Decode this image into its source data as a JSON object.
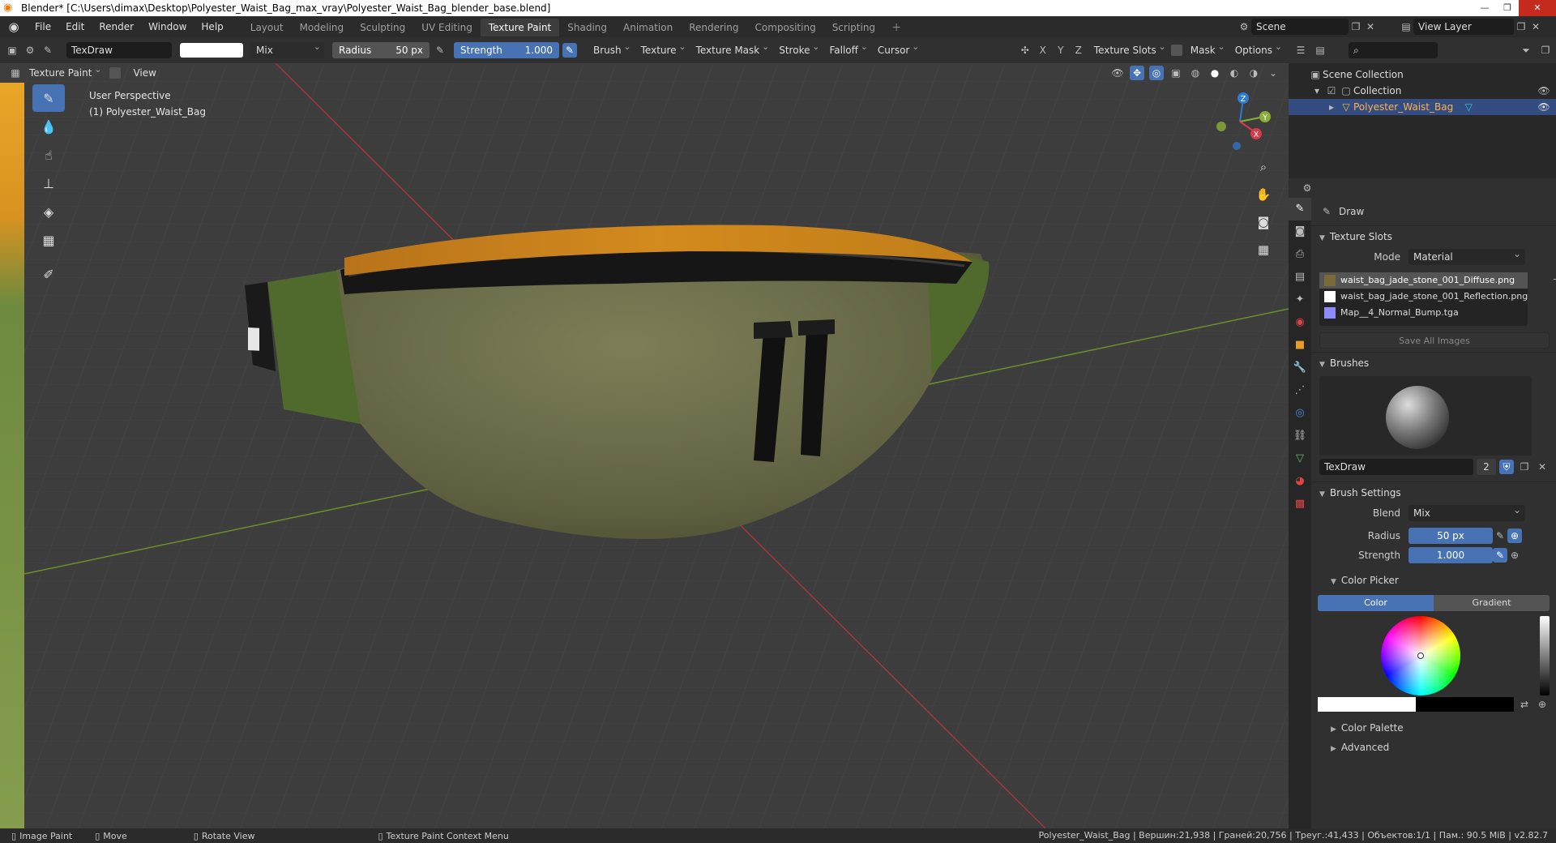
{
  "window": {
    "title": "Blender* [C:\\Users\\dimax\\Desktop\\Polyester_Waist_Bag_max_vray\\Polyester_Waist_Bag_blender_base.blend]"
  },
  "menus": [
    "File",
    "Edit",
    "Render",
    "Window",
    "Help"
  ],
  "workspaces": [
    {
      "label": "Layout",
      "active": false
    },
    {
      "label": "Modeling",
      "active": false
    },
    {
      "label": "Sculpting",
      "active": false
    },
    {
      "label": "UV Editing",
      "active": false
    },
    {
      "label": "Texture Paint",
      "active": true
    },
    {
      "label": "Shading",
      "active": false
    },
    {
      "label": "Animation",
      "active": false
    },
    {
      "label": "Rendering",
      "active": false
    },
    {
      "label": "Compositing",
      "active": false
    },
    {
      "label": "Scripting",
      "active": false
    }
  ],
  "topright": {
    "scene": "Scene",
    "view_layer": "View Layer"
  },
  "toolheader": {
    "brush_name": "TexDraw",
    "blend": "Mix",
    "radius_label": "Radius",
    "radius_value": "50 px",
    "strength_label": "Strength",
    "strength_value": "1.000",
    "menus": [
      "Brush",
      "Texture",
      "Texture Mask",
      "Stroke",
      "Falloff",
      "Cursor"
    ],
    "axes": [
      "X",
      "Y",
      "Z"
    ],
    "right_menus": [
      "Texture Slots",
      "Mask",
      "Options"
    ]
  },
  "viewheader": {
    "mode": "Texture Paint",
    "view": "View"
  },
  "viewport": {
    "perspective": "User Perspective",
    "object": "(1) Polyester_Waist_Bag",
    "gizmo": {
      "z": "Z",
      "y": "Y",
      "x": "X"
    }
  },
  "tools": [
    "brush-icon",
    "fill-icon",
    "smear-icon",
    "clone-icon",
    "mask-fill-icon",
    "clone-stamp-icon",
    "annotate-icon"
  ],
  "outliner": {
    "root": "Scene Collection",
    "collection": "Collection",
    "object": "Polyester_Waist_Bag"
  },
  "properties": {
    "tool_name": "Draw",
    "texture_slots": {
      "title": "Texture Slots",
      "mode_label": "Mode",
      "mode": "Material",
      "slots": [
        {
          "name": "waist_bag_jade_stone_001_Diffuse.png",
          "color": "#7a6a3a",
          "active": true
        },
        {
          "name": "waist_bag_jade_stone_001_Reflection.png",
          "color": "#ffffff",
          "active": false
        },
        {
          "name": "Map__4_Normal_Bump.tga",
          "color": "#8c8cff",
          "active": false
        }
      ],
      "save_all": "Save All Images"
    },
    "brushes": {
      "title": "Brushes",
      "name": "TexDraw",
      "users": "2"
    },
    "brush_settings": {
      "title": "Brush Settings",
      "blend_label": "Blend",
      "blend": "Mix",
      "radius_label": "Radius",
      "radius": "50 px",
      "strength_label": "Strength",
      "strength": "1.000"
    },
    "color_picker": {
      "title": "Color Picker",
      "tab_color": "Color",
      "tab_gradient": "Gradient"
    },
    "color_palette": "Color Palette",
    "advanced": "Advanced"
  },
  "statusbar": {
    "left": [
      {
        "icon": "mouse-left-icon",
        "label": "Image Paint"
      },
      {
        "icon": "mouse-drag-icon",
        "label": "Move"
      },
      {
        "icon": "mouse-middle-icon",
        "label": "Rotate View"
      },
      {
        "icon": "mouse-right-icon",
        "label": "Texture Paint Context Menu"
      }
    ],
    "stats": "Polyester_Waist_Bag | Вершин:21,938 | Граней:20,756 | Треуг.:41,433 | Объектов:1/1 | Пам.: 90.5 MiB | v2.82.7"
  },
  "colors": {
    "accent": "#4772b3",
    "header": "#303030",
    "viewport": "#3d3d3d",
    "bag_body": "#6b6b45",
    "bag_top": "#d48a1a"
  }
}
